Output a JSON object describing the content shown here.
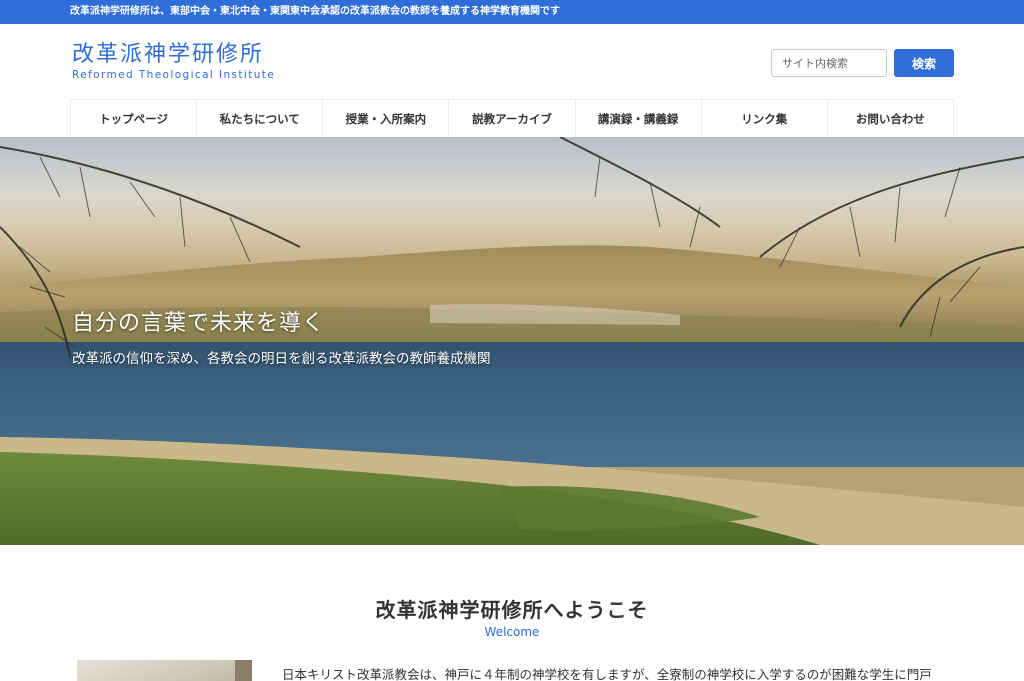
{
  "topbar": {
    "text": "改革派神学研修所は、東部中会・東北中会・東関東中会承認の改革派教会の教師を養成する神学教育機関です"
  },
  "header": {
    "logo_jp": "改革派神学研修所",
    "logo_en": "Reformed Theological Institute",
    "search": {
      "placeholder": "サイト内検索",
      "value": "",
      "button_label": "検索"
    }
  },
  "nav": {
    "items": [
      {
        "label": "トップページ"
      },
      {
        "label": "私たちについて"
      },
      {
        "label": "授業・入所案内"
      },
      {
        "label": "説教アーカイブ"
      },
      {
        "label": "講演録・講義録"
      },
      {
        "label": "リンク集"
      },
      {
        "label": "お問い合わせ"
      }
    ]
  },
  "hero": {
    "title": "自分の言葉で未来を導く",
    "subtitle": "改革派の信仰を深め、各教会の明日を創る改革派教会の教師養成機関"
  },
  "welcome": {
    "title": "改革派神学研修所へようこそ",
    "subtitle": "Welcome",
    "intro": "日本キリスト改革派教会は、神戸に４年制の神学校を有しますが、全寮制の神学校に入学するのが困難な学生に門戸"
  },
  "colors": {
    "accent": "#2f6dd9",
    "text": "#333333"
  }
}
